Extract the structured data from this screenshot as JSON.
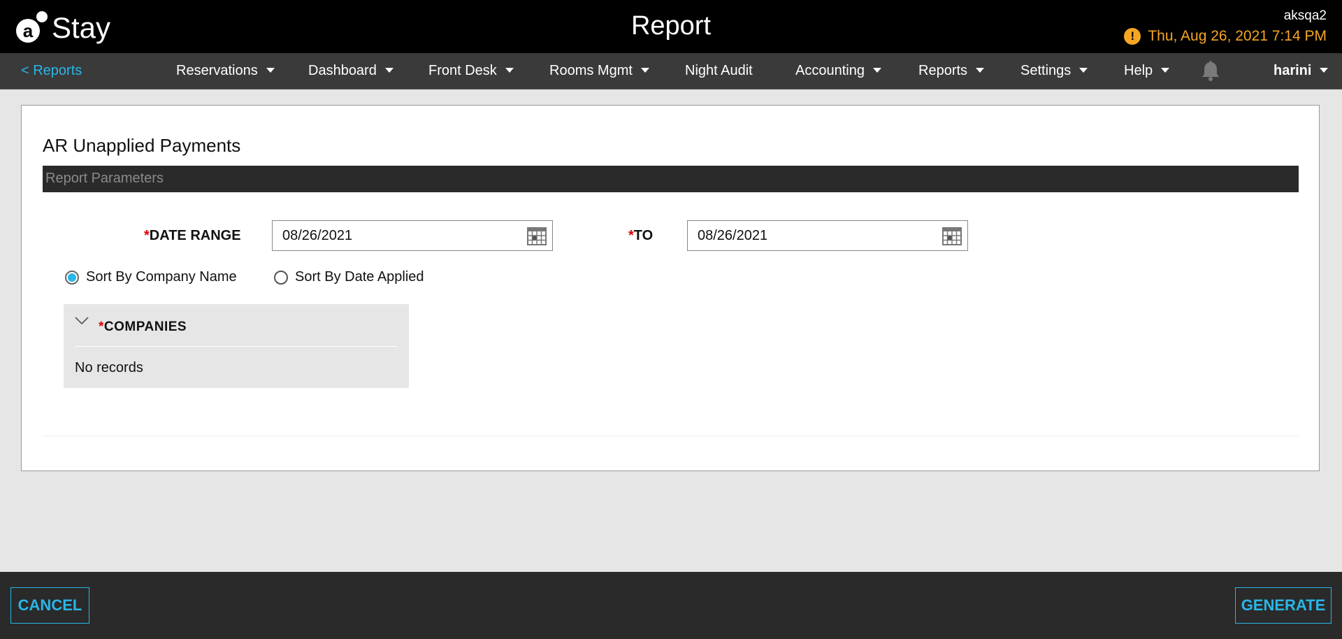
{
  "header": {
    "logo_text": "Stay",
    "title": "Report",
    "user_id": "aksqa2",
    "datetime": "Thu, Aug 26, 2021 7:14 PM",
    "warning_glyph": "!"
  },
  "nav": {
    "back_label": "< Reports",
    "items": [
      {
        "label": "Reservations",
        "dropdown": true
      },
      {
        "label": "Dashboard",
        "dropdown": true
      },
      {
        "label": "Front Desk",
        "dropdown": true
      },
      {
        "label": "Rooms Mgmt",
        "dropdown": true
      },
      {
        "label": "Night Audit",
        "dropdown": false
      },
      {
        "label": "Accounting",
        "dropdown": true
      },
      {
        "label": "Reports",
        "dropdown": true
      },
      {
        "label": "Settings",
        "dropdown": true
      },
      {
        "label": "Help",
        "dropdown": true
      }
    ],
    "user": "harini"
  },
  "report": {
    "title": "AR Unapplied Payments",
    "section": "Report Parameters",
    "required_mark": "*",
    "date_range_label": "DATE RANGE",
    "date_from": "08/26/2021",
    "to_label": "TO",
    "date_to": "08/26/2021",
    "sort_options": [
      {
        "label": "Sort By Company Name",
        "selected": true
      },
      {
        "label": "Sort By Date Applied",
        "selected": false
      }
    ],
    "companies_label": "COMPANIES",
    "companies_empty": "No records"
  },
  "footer": {
    "cancel_label": "CANCEL",
    "generate_label": "GENERATE"
  },
  "colors": {
    "accent": "#29b6e8",
    "warning": "#f5a623",
    "required": "#e00000",
    "header_bg": "#000000",
    "nav_bg": "#3a3a3a",
    "footer_bg": "#2a2a2a"
  }
}
